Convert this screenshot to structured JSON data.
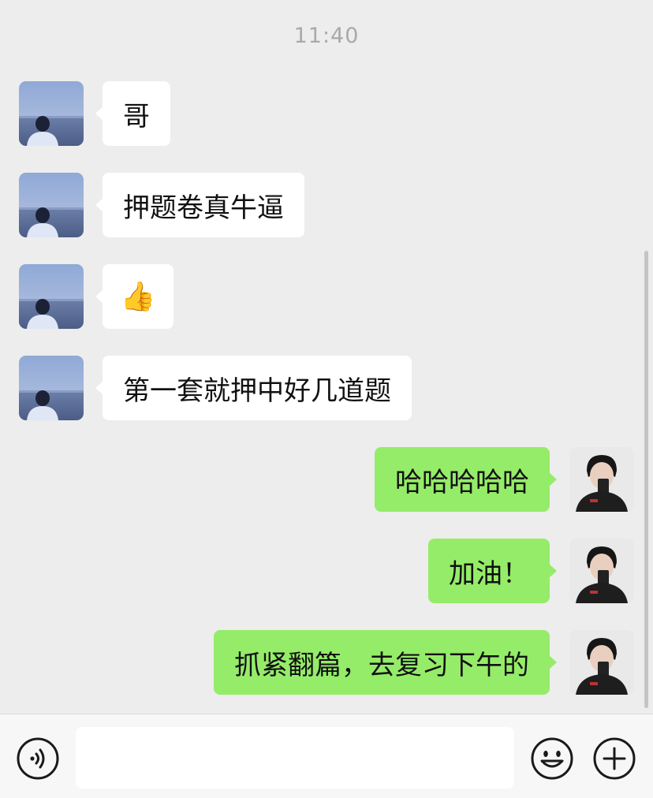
{
  "chat": {
    "timestamp": "11:40",
    "messages": [
      {
        "side": "in",
        "text": "哥"
      },
      {
        "side": "in",
        "text": "押题卷真牛逼"
      },
      {
        "side": "in",
        "text": "👍"
      },
      {
        "side": "in",
        "text": "第一套就押中好几道题"
      },
      {
        "side": "out",
        "text": "哈哈哈哈哈"
      },
      {
        "side": "out",
        "text": "加油！"
      },
      {
        "side": "out",
        "text": "抓紧翻篇，去复习下午的"
      }
    ]
  },
  "input_bar": {
    "voice_icon": "voice-icon",
    "emoji_icon": "emoji-icon",
    "plus_icon": "plus-icon",
    "message_value": ""
  },
  "colors": {
    "background": "#ededed",
    "incoming_bubble": "#ffffff",
    "outgoing_bubble": "#95ec69"
  }
}
